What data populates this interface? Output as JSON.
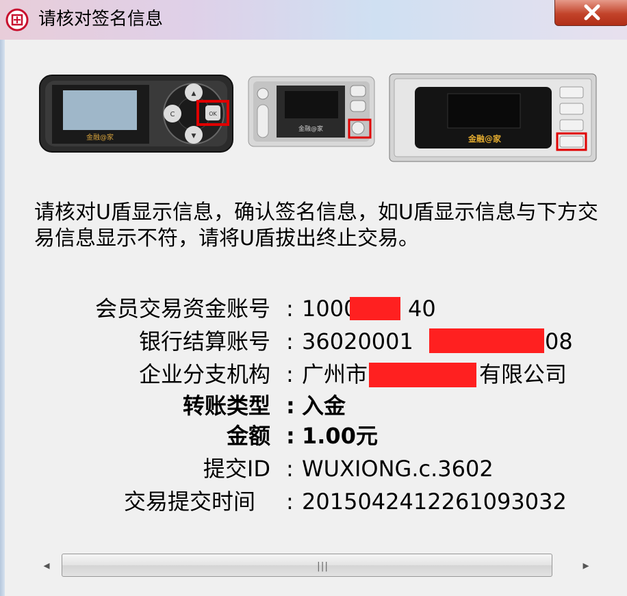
{
  "window": {
    "title": "请核对签名信息",
    "app_icon": "seal-icon",
    "close_label": "X"
  },
  "devices": [
    {
      "brand": "金融@家",
      "highlighted_button": "OK"
    },
    {
      "brand": "金融@家",
      "highlighted_button": "confirm"
    },
    {
      "brand": "金融@家",
      "highlighted_button": "confirm"
    }
  ],
  "instruction": "请核对U盾显示信息，确认签名信息，如U盾显示信息与下方交易信息显示不符，请将U盾拔出终止交易。",
  "fields": [
    {
      "label": "会员交易资金账号",
      "value": "1000",
      "value_tail": "40"
    },
    {
      "label": "银行结算账号",
      "value": "36020001",
      "value_tail": "08"
    },
    {
      "label": "企业分支机构",
      "value": "广州市",
      "value_tail": "有限公司"
    },
    {
      "label": "转账类型",
      "value": "入金"
    },
    {
      "label": "金额",
      "value": "1.00元"
    },
    {
      "label": "提交ID",
      "value": "WUXIONG.c.3602"
    },
    {
      "label": "交易提交时间",
      "value": "2015042412261093032"
    }
  ],
  "colors": {
    "redaction": "#ff2020",
    "highlight_box": "#e00000"
  }
}
